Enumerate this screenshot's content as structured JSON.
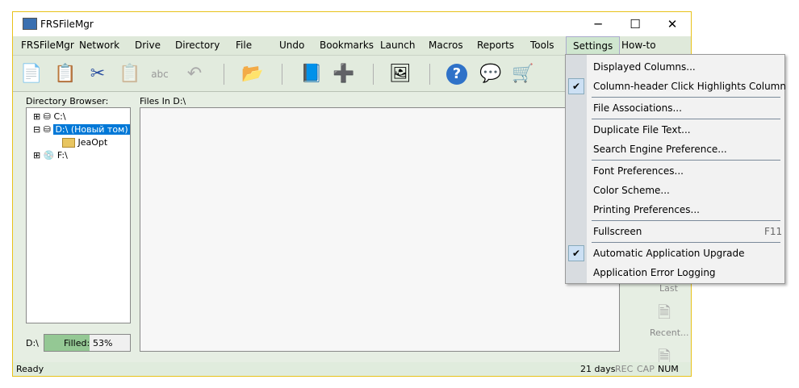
{
  "window": {
    "title": "FRSFileMgr",
    "minimize": "─",
    "maximize": "☐",
    "close": "✕"
  },
  "menubar": [
    "FRSFileMgr",
    "Network",
    "Drive",
    "Directory",
    "File",
    "Undo",
    "Bookmarks",
    "Launch",
    "Macros",
    "Reports",
    "Tools",
    "Settings",
    "How-to"
  ],
  "toolbar": [
    {
      "icon": "copy-icon",
      "g": "📄"
    },
    {
      "icon": "paste-icon",
      "g": "📋"
    },
    {
      "icon": "cut-icon",
      "g": "✂"
    },
    {
      "icon": "paste-disabled-icon",
      "g": "📋"
    },
    {
      "icon": "rename-icon",
      "g": "abc"
    },
    {
      "icon": "undo-icon",
      "g": "↶"
    },
    {
      "icon": "find-folder-icon",
      "g": "📂"
    },
    {
      "icon": "add-bookmark-icon",
      "g": "📘"
    },
    {
      "icon": "add-launch-icon",
      "g": "➕"
    },
    {
      "icon": "image-viewer-icon",
      "g": "🖼"
    },
    {
      "icon": "help-icon",
      "g": "?"
    },
    {
      "icon": "feedback-icon",
      "g": "💬"
    },
    {
      "icon": "shopping-cart-icon",
      "g": "🛒"
    }
  ],
  "directory": {
    "label": "Directory Browser:",
    "nodes": [
      "C:\\",
      "D:\\ (Новый том)",
      "JeaOpt",
      "F:\\"
    ]
  },
  "files": {
    "label": "Files In D:\\"
  },
  "drive": {
    "label": "D:\\",
    "filled_label": "Filled:",
    "filled_value": "53%",
    "percent": 53
  },
  "side": {
    "last": "Last",
    "recent": "Recent..."
  },
  "status": {
    "text": "Ready",
    "days": "21 days",
    "rec": "REC",
    "cap": "CAP",
    "num": "NUM"
  },
  "settings_menu": [
    {
      "label": "Displayed Columns...",
      "checked": false
    },
    {
      "label": "Column-header Click Highlights Column",
      "checked": true
    },
    {
      "label": "File Associations...",
      "checked": false
    },
    {
      "label": "Duplicate File Text...",
      "checked": false
    },
    {
      "label": "Search Engine Preference...",
      "checked": false
    },
    {
      "label": "Font Preferences...",
      "checked": false
    },
    {
      "label": "Color Scheme...",
      "checked": false
    },
    {
      "label": "Printing Preferences...",
      "checked": false
    },
    {
      "label": "Fullscreen",
      "shortcut": "F11",
      "checked": false
    },
    {
      "label": "Automatic Application Upgrade",
      "checked": true
    },
    {
      "label": "Application Error Logging",
      "checked": false
    }
  ],
  "check_glyph": "✔"
}
